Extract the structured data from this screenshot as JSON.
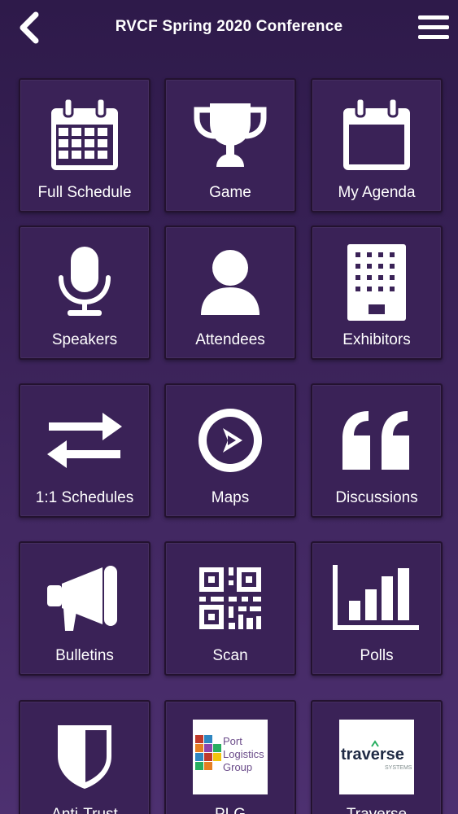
{
  "header": {
    "title": "RVCF Spring 2020 Conference",
    "back_icon": "chevron-left-icon",
    "menu_icon": "hamburger-menu-icon"
  },
  "colors": {
    "background_top": "#2e1a4a",
    "background_bottom": "#4d3070",
    "tile": "#3a2257",
    "tile_border": "#23122f"
  },
  "tiles": [
    {
      "label": "Full Schedule",
      "icon": "calendar-grid-icon"
    },
    {
      "label": "Game",
      "icon": "trophy-icon"
    },
    {
      "label": "My Agenda",
      "icon": "calendar-icon"
    },
    {
      "label": "Speakers",
      "icon": "microphone-icon"
    },
    {
      "label": "Attendees",
      "icon": "person-icon"
    },
    {
      "label": "Exhibitors",
      "icon": "building-icon"
    },
    {
      "label": "1:1 Schedules",
      "icon": "swap-arrows-icon"
    },
    {
      "label": "Maps",
      "icon": "compass-icon"
    },
    {
      "label": "Discussions",
      "icon": "quote-icon"
    },
    {
      "label": "Bulletins",
      "icon": "megaphone-icon"
    },
    {
      "label": "Scan",
      "icon": "qr-code-icon"
    },
    {
      "label": "Polls",
      "icon": "bar-chart-icon"
    },
    {
      "label": "Anti-Trust",
      "icon": "shield-icon"
    },
    {
      "label": "PLG",
      "icon": "port-logistics-logo",
      "logo_text": [
        "Port",
        "Logistics",
        "Group"
      ]
    },
    {
      "label": "Traverse",
      "icon": "traverse-logo",
      "logo_text": [
        "traverse",
        "SYSTEMS"
      ]
    }
  ]
}
